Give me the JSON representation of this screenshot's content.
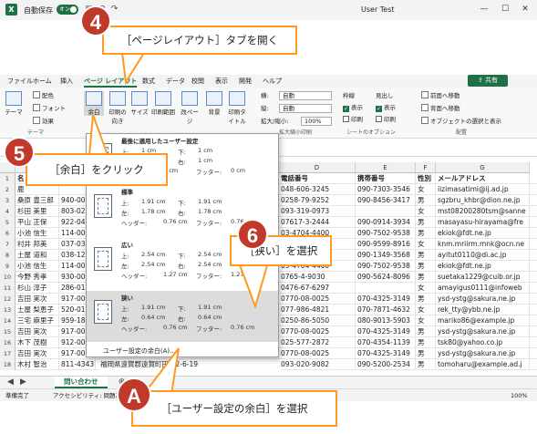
{
  "titlebar": {
    "app_icon": "X",
    "autosave_label": "自動保存",
    "autosave_state": "オン",
    "user": "User Test"
  },
  "menubar": {
    "items": [
      "ファイル",
      "ホーム",
      "挿入",
      "ページ レイアウト",
      "数式",
      "データ",
      "校閲",
      "表示",
      "開発",
      "ヘルプ"
    ],
    "active_index": 3,
    "share_label": "共有"
  },
  "ribbon": {
    "theme_group": {
      "theme_label": "テーマ",
      "colors_label": "配色",
      "fonts_label": "フォント",
      "effects_label": "効果",
      "group_label": "テーマ"
    },
    "page_setup": {
      "margins_label": "余白",
      "orientation_label": "印刷の向き",
      "size_label": "サイズ",
      "print_area_label": "印刷範囲",
      "breaks_label": "改ページ",
      "background_label": "背景",
      "titles_label": "印刷タイトル"
    },
    "scale_group": {
      "width_label": "横:",
      "width_value": "自動",
      "height_label": "縦:",
      "height_value": "自動",
      "scale_label": "拡大/縮小:",
      "scale_value": "100%",
      "group_label": "拡大縮小印刷"
    },
    "sheet_options": {
      "gridlines_label": "枠線",
      "headings_label": "見出し",
      "view_label": "表示",
      "print_label": "印刷",
      "group_label": "シートのオプション"
    },
    "arrange": {
      "forward_label": "前面へ移動",
      "backward_label": "背面へ移動",
      "selection_label": "オブジェクトの選択と表示",
      "group_label": "配置"
    }
  },
  "sheet": {
    "columns": [
      "D",
      "E",
      "F",
      "G"
    ],
    "col_a_label": "A",
    "headers": {
      "a": "名",
      "d": "電話番号",
      "e": "携帯番号",
      "f": "性別",
      "g": "メールアドレス"
    },
    "rows": [
      {
        "n": "2",
        "name": "鹿",
        "b": "",
        "d": "048-606-3245",
        "e": "090-7303-3546",
        "f": "女",
        "g": "iizimasatimi@ij.ad.jp"
      },
      {
        "n": "3",
        "name": "桑原 豊三郎",
        "b": "940-00",
        "d": "0258-79-9252",
        "e": "090-8456-3417",
        "f": "男",
        "g": "sgzbru_khbr@dion.ne.jp"
      },
      {
        "n": "4",
        "name": "杉田 美里",
        "b": "803-02",
        "d": "093-319-0973",
        "e": "",
        "f": "女",
        "g": "mst08200280tsm@sanne"
      },
      {
        "n": "5",
        "name": "平山 正保",
        "b": "922-04",
        "d": "07617-3-2444",
        "e": "090-0914-3934",
        "f": "男",
        "g": "masayasu-hirayama@fre"
      },
      {
        "n": "6",
        "name": "小池 信生",
        "b": "114-00",
        "d": "03-4704-4400",
        "e": "090-7502-9538",
        "f": "男",
        "g": "ekiok@fdt.ne.jp"
      },
      {
        "n": "7",
        "name": "村井 邦美",
        "b": "037-03",
        "d": "0175-4-9866",
        "e": "090-9599-8916",
        "f": "女",
        "g": "knm.mriirm.mnk@ocn.ne"
      },
      {
        "n": "8",
        "name": "土屋 道和",
        "b": "038-12",
        "d": "0172-25-1067",
        "e": "090-1349-3568",
        "f": "男",
        "g": "ayitut0110@di.ac.jp"
      },
      {
        "n": "9",
        "name": "小池 信生",
        "b": "114-00",
        "d": "03-4704-4400",
        "e": "090-7502-9538",
        "f": "男",
        "g": "ekiok@fdt.ne.jp"
      },
      {
        "n": "10",
        "name": "今野 秀孝",
        "b": "930-00",
        "d": "0765-4-9030",
        "e": "090-5624-8096",
        "f": "男",
        "g": "suetaka1229@cuib.or.jp"
      },
      {
        "n": "11",
        "name": "杉山 淳子",
        "b": "286-01",
        "d": "0476-67-6297",
        "e": "",
        "f": "女",
        "g": "amayigus0111@infoweb"
      },
      {
        "n": "12",
        "name": "吉田 実次",
        "b": "917-00",
        "d": "0770-08-0025",
        "e": "070-4325-3149",
        "f": "男",
        "g": "ysd-ystg@sakura.ne.jp"
      },
      {
        "n": "13",
        "name": "土屋 梨恵子",
        "b": "520-01",
        "d": "077-986-4821",
        "e": "070-7871-4632",
        "f": "女",
        "g": "rek_tty@ybb.ne.jp"
      },
      {
        "n": "14",
        "name": "三宅 麻里子",
        "b": "959-18",
        "d": "0250-86-5050",
        "e": "080-9013-5903",
        "f": "女",
        "g": "mariko86@example.jp"
      },
      {
        "n": "15",
        "name": "吉田 実次",
        "b": "917-00",
        "d": "0770-08-0025",
        "e": "070-4325-3149",
        "f": "男",
        "g": "ysd-ystg@sakura.ne.jp"
      },
      {
        "n": "16",
        "name": "木下 茂樹",
        "b": "912-00",
        "d": "025-577-2872",
        "e": "070-4354-1139",
        "f": "男",
        "g": "tsk80@yahoo.co.jp"
      },
      {
        "n": "17",
        "name": "吉田 実次",
        "b": "917-00",
        "d": "0770-08-0025",
        "e": "070-4325-3149",
        "f": "男",
        "g": "ysd-ystg@sakura.ne.jp"
      },
      {
        "n": "18",
        "name": "木村 智治",
        "b": "811-4343",
        "d": "093-020-9082",
        "e": "090-5200-2534",
        "f": "男",
        "g": "tomoharu@example.ad.j"
      }
    ],
    "row18_address": "福岡県遠賀郡遠賀町田園2-6-19"
  },
  "sheettab": {
    "label": "問い合わせ"
  },
  "status": {
    "ready": "準備完了",
    "accessibility": "アクセシビリティ: 問題あり",
    "zoom": "100%"
  },
  "dropdown": {
    "presets": [
      {
        "title": "最後に適用したユーザー設定",
        "top_label": "上:",
        "top": "1 cm",
        "bottom_label": "下:",
        "bottom": "1 cm",
        "left_label": "左:",
        "left": "1 cm",
        "right_label": "右:",
        "right": "1 cm",
        "header_label": "ヘッダー:",
        "header": "0 cm",
        "footer_label": "フッター:",
        "footer": "0 cm"
      },
      {
        "title": "標準",
        "top_label": "上:",
        "top": "1.91 cm",
        "bottom_label": "下:",
        "bottom": "1.91 cm",
        "left_label": "左:",
        "left": "1.78 cm",
        "right_label": "右:",
        "right": "1.78 cm",
        "header_label": "ヘッダー:",
        "header": "0.76 cm",
        "footer_label": "フッター:",
        "footer": "0.76 cm"
      },
      {
        "title": "広い",
        "top_label": "上:",
        "top": "2.54 cm",
        "bottom_label": "下:",
        "bottom": "2.54 cm",
        "left_label": "左:",
        "left": "2.54 cm",
        "right_label": "右:",
        "right": "2.54 cm",
        "header_label": "ヘッダー:",
        "header": "1.27 cm",
        "footer_label": "フッター:",
        "footer": "1.27 cm"
      },
      {
        "title": "狭い",
        "top_label": "上:",
        "top": "1.91 cm",
        "bottom_label": "下:",
        "bottom": "1.91 cm",
        "left_label": "左:",
        "left": "0.64 cm",
        "right_label": "右:",
        "right": "0.64 cm",
        "header_label": "ヘッダー:",
        "header": "0.76 cm",
        "footer_label": "フッター:",
        "footer": "0.76 cm"
      }
    ],
    "custom_label": "ユーザー設定の余白(A)..."
  },
  "callouts": {
    "c4": {
      "num": "4",
      "text": "［ページレイアウト］タブを開く"
    },
    "c5": {
      "num": "5",
      "text": "［余白］をクリック"
    },
    "c6": {
      "num": "6",
      "text": "［狭い］を選択"
    },
    "cA": {
      "num": "A",
      "text": "［ユーザー設定の余白］を選択"
    }
  },
  "colors": {
    "excel_green": "#1e7145",
    "callout_orange": "#ff9a1e",
    "badge_red": "#c0392b"
  }
}
